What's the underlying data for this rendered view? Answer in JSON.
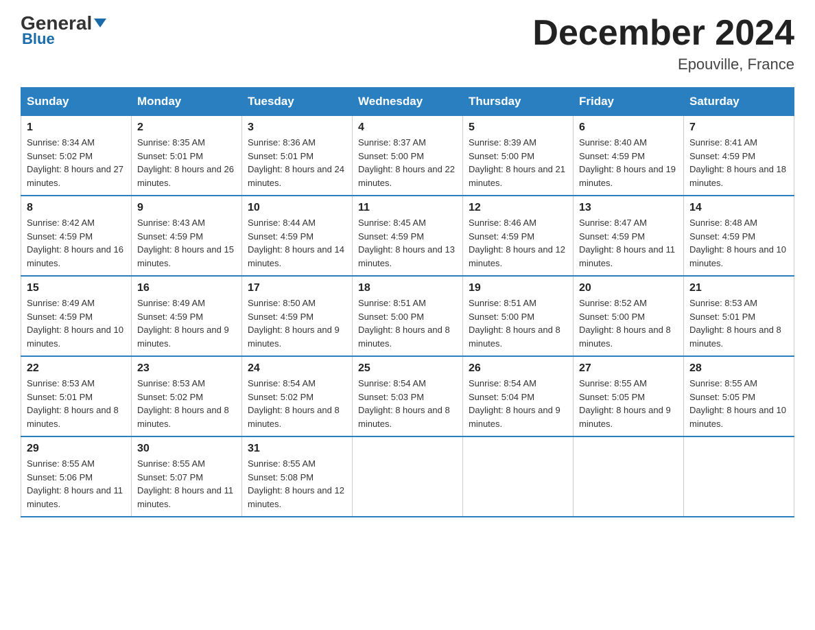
{
  "logo": {
    "part1": "General",
    "part2": "Blue"
  },
  "title": "December 2024",
  "location": "Epouville, France",
  "days_of_week": [
    "Sunday",
    "Monday",
    "Tuesday",
    "Wednesday",
    "Thursday",
    "Friday",
    "Saturday"
  ],
  "weeks": [
    [
      {
        "num": "1",
        "sunrise": "8:34 AM",
        "sunset": "5:02 PM",
        "daylight": "8 hours and 27 minutes."
      },
      {
        "num": "2",
        "sunrise": "8:35 AM",
        "sunset": "5:01 PM",
        "daylight": "8 hours and 26 minutes."
      },
      {
        "num": "3",
        "sunrise": "8:36 AM",
        "sunset": "5:01 PM",
        "daylight": "8 hours and 24 minutes."
      },
      {
        "num": "4",
        "sunrise": "8:37 AM",
        "sunset": "5:00 PM",
        "daylight": "8 hours and 22 minutes."
      },
      {
        "num": "5",
        "sunrise": "8:39 AM",
        "sunset": "5:00 PM",
        "daylight": "8 hours and 21 minutes."
      },
      {
        "num": "6",
        "sunrise": "8:40 AM",
        "sunset": "4:59 PM",
        "daylight": "8 hours and 19 minutes."
      },
      {
        "num": "7",
        "sunrise": "8:41 AM",
        "sunset": "4:59 PM",
        "daylight": "8 hours and 18 minutes."
      }
    ],
    [
      {
        "num": "8",
        "sunrise": "8:42 AM",
        "sunset": "4:59 PM",
        "daylight": "8 hours and 16 minutes."
      },
      {
        "num": "9",
        "sunrise": "8:43 AM",
        "sunset": "4:59 PM",
        "daylight": "8 hours and 15 minutes."
      },
      {
        "num": "10",
        "sunrise": "8:44 AM",
        "sunset": "4:59 PM",
        "daylight": "8 hours and 14 minutes."
      },
      {
        "num": "11",
        "sunrise": "8:45 AM",
        "sunset": "4:59 PM",
        "daylight": "8 hours and 13 minutes."
      },
      {
        "num": "12",
        "sunrise": "8:46 AM",
        "sunset": "4:59 PM",
        "daylight": "8 hours and 12 minutes."
      },
      {
        "num": "13",
        "sunrise": "8:47 AM",
        "sunset": "4:59 PM",
        "daylight": "8 hours and 11 minutes."
      },
      {
        "num": "14",
        "sunrise": "8:48 AM",
        "sunset": "4:59 PM",
        "daylight": "8 hours and 10 minutes."
      }
    ],
    [
      {
        "num": "15",
        "sunrise": "8:49 AM",
        "sunset": "4:59 PM",
        "daylight": "8 hours and 10 minutes."
      },
      {
        "num": "16",
        "sunrise": "8:49 AM",
        "sunset": "4:59 PM",
        "daylight": "8 hours and 9 minutes."
      },
      {
        "num": "17",
        "sunrise": "8:50 AM",
        "sunset": "4:59 PM",
        "daylight": "8 hours and 9 minutes."
      },
      {
        "num": "18",
        "sunrise": "8:51 AM",
        "sunset": "5:00 PM",
        "daylight": "8 hours and 8 minutes."
      },
      {
        "num": "19",
        "sunrise": "8:51 AM",
        "sunset": "5:00 PM",
        "daylight": "8 hours and 8 minutes."
      },
      {
        "num": "20",
        "sunrise": "8:52 AM",
        "sunset": "5:00 PM",
        "daylight": "8 hours and 8 minutes."
      },
      {
        "num": "21",
        "sunrise": "8:53 AM",
        "sunset": "5:01 PM",
        "daylight": "8 hours and 8 minutes."
      }
    ],
    [
      {
        "num": "22",
        "sunrise": "8:53 AM",
        "sunset": "5:01 PM",
        "daylight": "8 hours and 8 minutes."
      },
      {
        "num": "23",
        "sunrise": "8:53 AM",
        "sunset": "5:02 PM",
        "daylight": "8 hours and 8 minutes."
      },
      {
        "num": "24",
        "sunrise": "8:54 AM",
        "sunset": "5:02 PM",
        "daylight": "8 hours and 8 minutes."
      },
      {
        "num": "25",
        "sunrise": "8:54 AM",
        "sunset": "5:03 PM",
        "daylight": "8 hours and 8 minutes."
      },
      {
        "num": "26",
        "sunrise": "8:54 AM",
        "sunset": "5:04 PM",
        "daylight": "8 hours and 9 minutes."
      },
      {
        "num": "27",
        "sunrise": "8:55 AM",
        "sunset": "5:05 PM",
        "daylight": "8 hours and 9 minutes."
      },
      {
        "num": "28",
        "sunrise": "8:55 AM",
        "sunset": "5:05 PM",
        "daylight": "8 hours and 10 minutes."
      }
    ],
    [
      {
        "num": "29",
        "sunrise": "8:55 AM",
        "sunset": "5:06 PM",
        "daylight": "8 hours and 11 minutes."
      },
      {
        "num": "30",
        "sunrise": "8:55 AM",
        "sunset": "5:07 PM",
        "daylight": "8 hours and 11 minutes."
      },
      {
        "num": "31",
        "sunrise": "8:55 AM",
        "sunset": "5:08 PM",
        "daylight": "8 hours and 12 minutes."
      },
      null,
      null,
      null,
      null
    ]
  ]
}
